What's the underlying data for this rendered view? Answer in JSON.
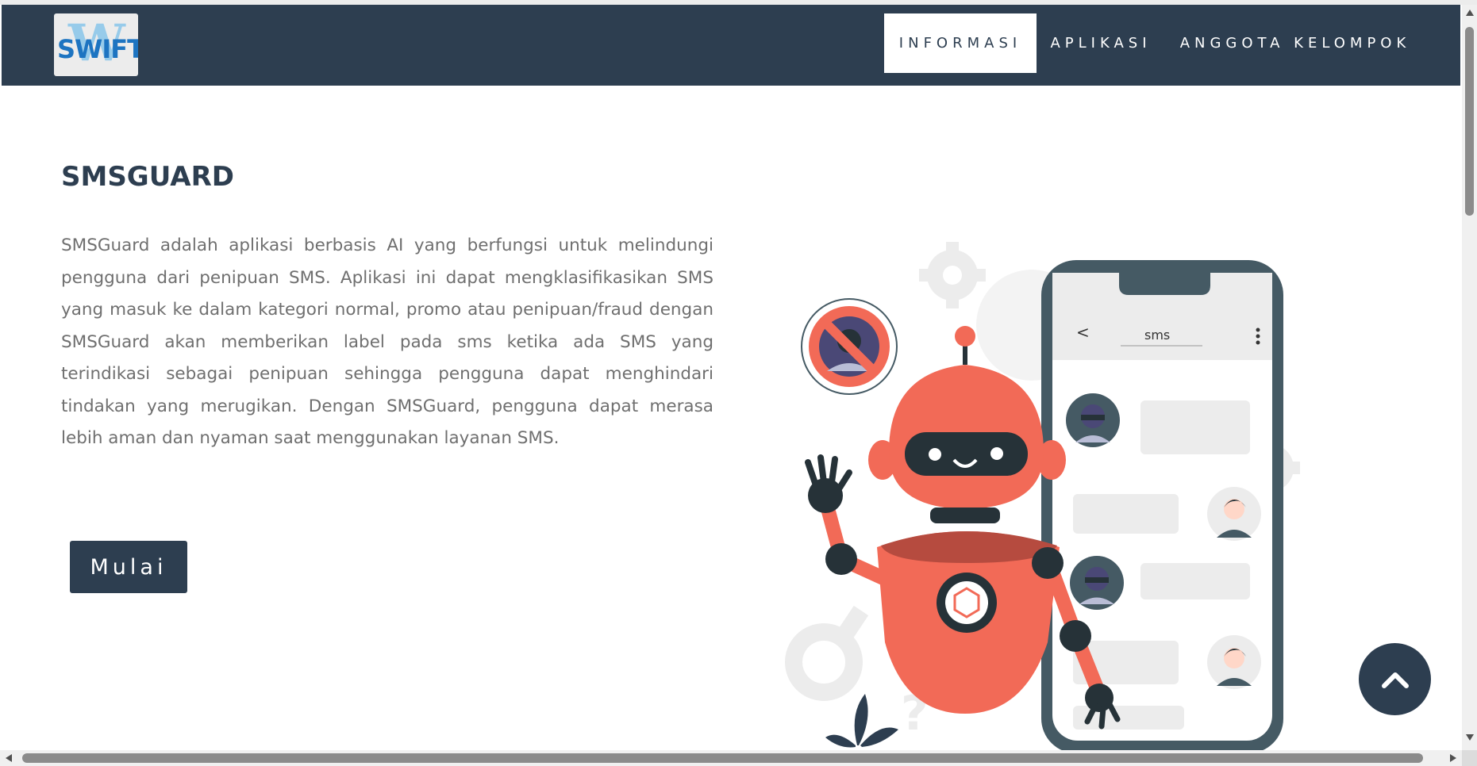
{
  "logo": {
    "text": "SWIFT",
    "alt": "SWIFT logo"
  },
  "nav": {
    "items": [
      {
        "label": "INFORMASI",
        "active": true
      },
      {
        "label": "APLIKASI",
        "active": false
      },
      {
        "label": "ANGGOTA KELOMPOK",
        "active": false
      }
    ]
  },
  "main": {
    "title": "SMSGUARD",
    "description": "SMSGuard adalah aplikasi berbasis AI yang berfungsi untuk melindungi pengguna dari penipuan SMS. Aplikasi ini dapat mengklasifikasikan SMS yang masuk ke dalam kategori normal, promo atau penipuan/fraud dengan SMSGuard akan memberikan label pada sms ketika ada SMS yang terindikasi sebagai penipuan sehingga pengguna dapat menghindari tindakan yang merugikan. Dengan SMSGuard, pengguna dapat merasa lebih aman dan nyaman saat menggunakan layanan SMS.",
    "start_label": "Mulai"
  },
  "illustration": {
    "phone_back": "<",
    "phone_title": "sms"
  },
  "colors": {
    "navbar": "#2d3e50",
    "robot": "#f26a57",
    "text": "#6f6f6f"
  },
  "icons": {
    "back_to_top": "chevron-up-icon"
  }
}
